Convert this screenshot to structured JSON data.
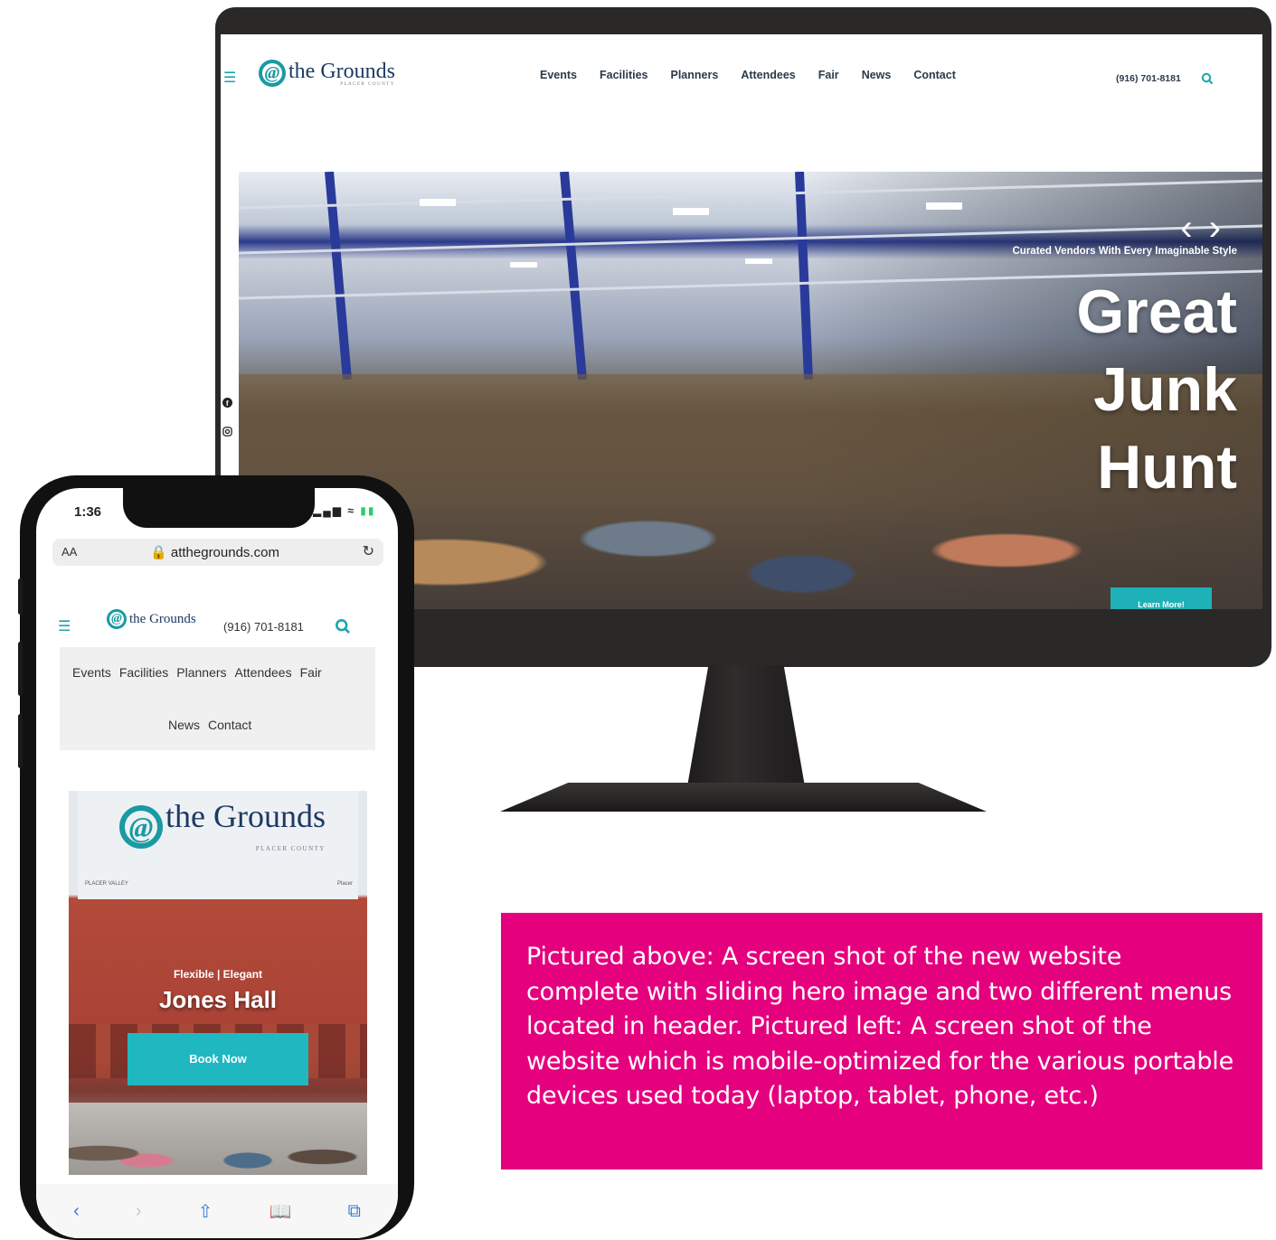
{
  "desktop": {
    "logo_text": "the Grounds",
    "logo_sub": "PLACER COUNTY",
    "nav": [
      "Events",
      "Facilities",
      "Planners",
      "Attendees",
      "Fair",
      "News",
      "Contact"
    ],
    "phone": "(916) 701-8181",
    "hero": {
      "subtitle": "Curated Vendors With Every Imaginable Style",
      "title_lines": [
        "Great",
        "Junk",
        "Hunt"
      ],
      "button": "Learn More!"
    }
  },
  "mobile": {
    "time": "1:36",
    "url_prefix": "AA",
    "url": "atthegrounds.com",
    "logo_text": "the Grounds",
    "phone": "(916) 701-8181",
    "nav_row1": [
      "Events",
      "Facilities",
      "Planners",
      "Attendees",
      "Fair"
    ],
    "nav_row2": [
      "News",
      "Contact"
    ],
    "banner": {
      "logo_text": "the Grounds",
      "logo_sub": "PLACER COUNTY",
      "left_tag": "PLACER VALLEY",
      "right_tag": "Placer"
    },
    "hero": {
      "subtitle": "Flexible | Elegant",
      "title": "Jones Hall",
      "button": "Book Now"
    }
  },
  "caption": "Pictured above: A screen shot of the new website complete with sliding hero image and two different menus located in header. Pictured left: A screen shot of the website which is mobile-optimized for the various portable devices used today (laptop, tablet, phone, etc.)",
  "colors": {
    "accent": "#1fb1b8",
    "logo_navy": "#1d3a63",
    "caption_bg": "#e5007e",
    "device_frame": "#2b2828"
  }
}
